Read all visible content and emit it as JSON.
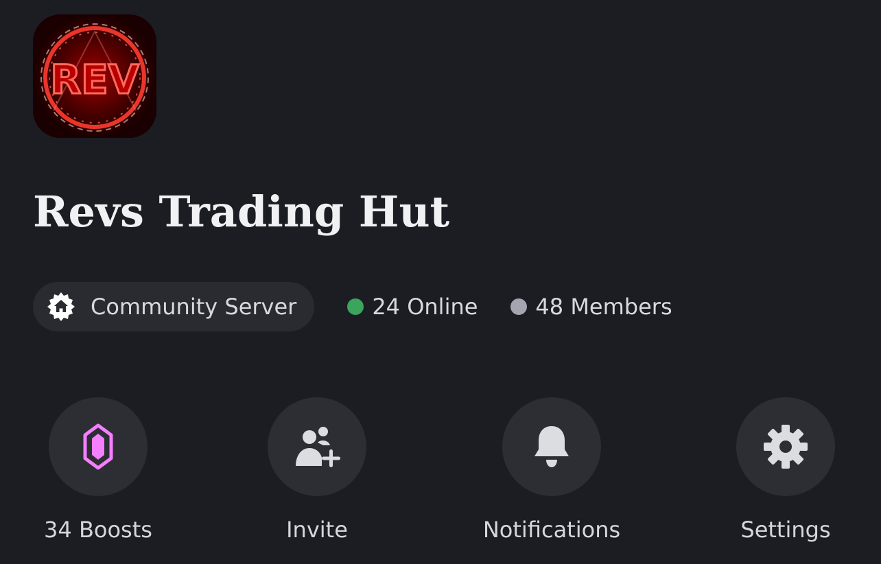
{
  "server": {
    "name": "Revs Trading Hut",
    "icon_text": "REV"
  },
  "info": {
    "community_label": "Community Server",
    "online": "24 Online",
    "members": "48 Members"
  },
  "colors": {
    "online_dot": "#3ba55c",
    "members_dot": "#a3a6b0",
    "boost_accent": "#f47fff"
  },
  "actions": [
    {
      "label": "34 Boosts",
      "icon": "boost-gem-icon"
    },
    {
      "label": "Invite",
      "icon": "add-friend-icon"
    },
    {
      "label": "Notifications",
      "icon": "bell-icon"
    },
    {
      "label": "Settings",
      "icon": "gear-icon"
    }
  ]
}
